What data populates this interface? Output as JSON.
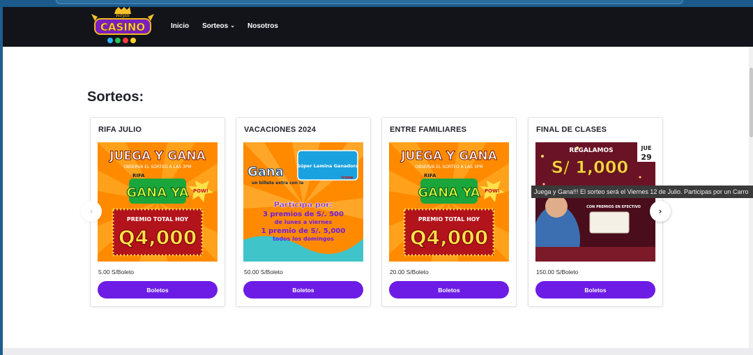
{
  "colors": {
    "nav_bg": "#12141a",
    "accent": "#6d1ce6",
    "banner_orange": "#ff8a00",
    "banner_green": "#21c44b",
    "banner_red": "#c81e1e"
  },
  "logo": {
    "word": "CASINO",
    "top_word": "Royal"
  },
  "nav": {
    "items": [
      {
        "label": "Inicio"
      },
      {
        "label": "Sorteos",
        "icon": "chevron-down-icon"
      },
      {
        "label": "Nosotros"
      }
    ]
  },
  "section": {
    "title": "Sorteos:"
  },
  "cards": [
    {
      "title": "RIFA JULIO",
      "price": "5.00 S/Boleto",
      "button": "Boletos",
      "banner": {
        "headline": "JUEGA Y GANA",
        "sub": "OBSERVA EL SORTEO A LAS 3PM",
        "game": "GANA YA",
        "game_tag": "RIFA",
        "burst": "POW!",
        "prize_label": "PREMIO TOTAL HOY",
        "prize": "Q4,000"
      }
    },
    {
      "title": "VACACIONES 2024",
      "price": "50.00 S/Boleto",
      "button": "Boletos",
      "banner": {
        "headline": "Gana",
        "sub": "un billete extra con la",
        "brand": "Súper Lamina Ganadora",
        "brand_tag": "trome",
        "line1": "Participa por:",
        "line2": "3 premios de S/. 500",
        "line3": "de lunes a viernes",
        "line4": "1 premio de S/. 5,000",
        "line5": "todos los domingos"
      }
    },
    {
      "title": "ENTRE FAMILIARES",
      "price": "20.00 S/Boleto",
      "button": "Boletos",
      "banner": {
        "headline": "JUEGA Y GANA",
        "sub": "OBSERVA EL SORTEO A LAS 3PM",
        "game": "GANA YA",
        "game_tag": "RIFA",
        "burst": "POW!",
        "prize_label": "PREMIO TOTAL HOY",
        "prize": "Q4,000"
      }
    },
    {
      "title": "FINAL DE CLASES",
      "price": "150.00 S/Boleto",
      "button": "Boletos",
      "banner": {
        "headline": "REGALAMOS",
        "amount": "S/ 1,000",
        "day": "JUE",
        "date": "29",
        "sub": "CON PREMIOS EN EFECTIVO"
      }
    }
  ],
  "tooltip": "Juega y Gana!!! El sorteo será el Viernes 12 de Julio. Participas por un Carro"
}
